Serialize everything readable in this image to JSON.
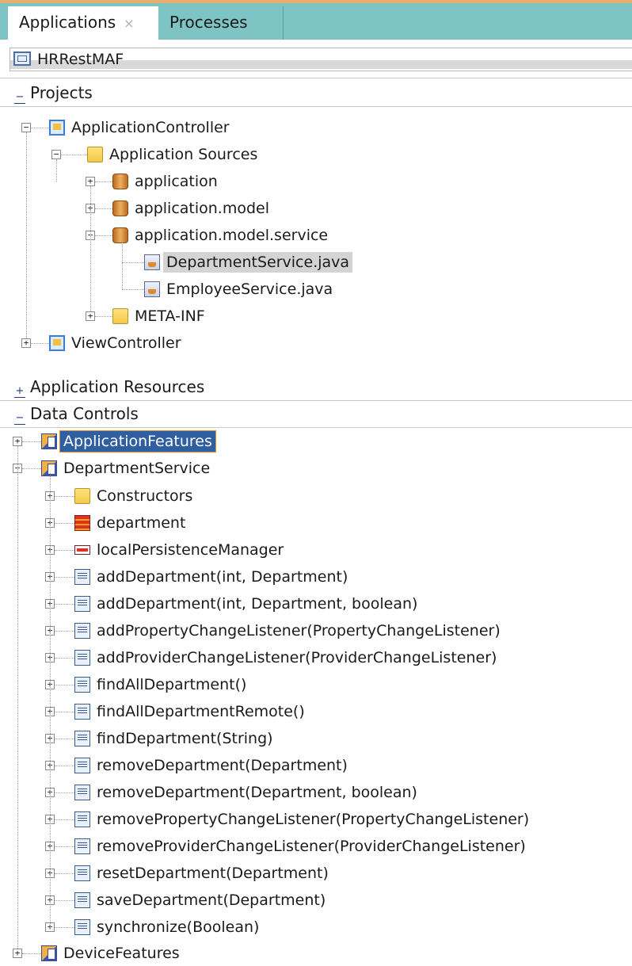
{
  "tabs": [
    {
      "label": "Applications",
      "close": "×"
    },
    {
      "label": "Processes"
    }
  ],
  "application_selector": {
    "value": "HRRestMAF"
  },
  "sections": {
    "projects": {
      "toggle": "−",
      "label": "Projects"
    },
    "application_resources": {
      "toggle": "+",
      "label": "Application Resources"
    },
    "data_controls": {
      "toggle": "−",
      "label": "Data Controls"
    }
  },
  "projects_tree": [
    {
      "label": "ApplicationController",
      "icon": "project-icon",
      "expanded": true
    },
    {
      "label": "Application Sources",
      "icon": "folder-icon",
      "expanded": true
    },
    {
      "label": "application",
      "icon": "package-icon",
      "expanded": false
    },
    {
      "label": "application.model",
      "icon": "package-icon",
      "expanded": false
    },
    {
      "label": "application.model.service",
      "icon": "package-icon",
      "expanded": true
    },
    {
      "label": "DepartmentService.java",
      "icon": "java-file-icon",
      "selected": true
    },
    {
      "label": "EmployeeService.java",
      "icon": "java-file-icon"
    },
    {
      "label": "META-INF",
      "icon": "folder-icon",
      "expanded": false
    },
    {
      "label": "ViewController",
      "icon": "project-icon",
      "expanded": false
    }
  ],
  "data_controls_tree": [
    {
      "label": "ApplicationFeatures",
      "icon": "data-control-icon",
      "expanded": false,
      "selected": true
    },
    {
      "label": "DepartmentService",
      "icon": "data-control-icon",
      "expanded": true
    },
    {
      "label": "Constructors",
      "icon": "folder-icon"
    },
    {
      "label": "department",
      "icon": "collection-icon"
    },
    {
      "label": "localPersistenceManager",
      "icon": "attribute-icon"
    },
    {
      "label": "addDepartment(int, Department)",
      "icon": "method-icon"
    },
    {
      "label": "addDepartment(int, Department, boolean)",
      "icon": "method-icon"
    },
    {
      "label": "addPropertyChangeListener(PropertyChangeListener)",
      "icon": "method-icon"
    },
    {
      "label": "addProviderChangeListener(ProviderChangeListener)",
      "icon": "method-icon"
    },
    {
      "label": "findAllDepartment()",
      "icon": "method-icon"
    },
    {
      "label": "findAllDepartmentRemote()",
      "icon": "method-icon"
    },
    {
      "label": "findDepartment(String)",
      "icon": "method-icon"
    },
    {
      "label": "removeDepartment(Department)",
      "icon": "method-icon"
    },
    {
      "label": "removeDepartment(Department, boolean)",
      "icon": "method-icon"
    },
    {
      "label": "removePropertyChangeListener(PropertyChangeListener)",
      "icon": "method-icon"
    },
    {
      "label": "removeProviderChangeListener(ProviderChangeListener)",
      "icon": "method-icon"
    },
    {
      "label": "resetDepartment(Department)",
      "icon": "method-icon"
    },
    {
      "label": "saveDepartment(Department)",
      "icon": "method-icon"
    },
    {
      "label": "synchronize(Boolean)",
      "icon": "method-icon"
    },
    {
      "label": "DeviceFeatures",
      "icon": "data-control-icon",
      "expanded": false
    }
  ],
  "expander_glyphs": {
    "collapsed": "+",
    "expanded": "−"
  }
}
